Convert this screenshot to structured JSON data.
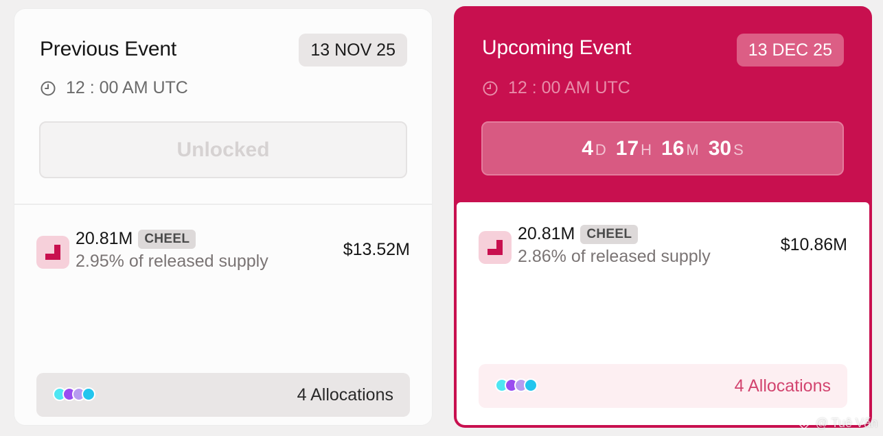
{
  "previous_event": {
    "title": "Previous Event",
    "date": "13 NOV 25",
    "time": "12 : 00 AM UTC",
    "status": "Unlocked",
    "token": {
      "amount": "20.81M",
      "ticker": "CHEEL",
      "supply": "2.95% of released supply",
      "value": "$13.52M"
    },
    "allocations_label": "4 Allocations"
  },
  "upcoming_event": {
    "title": "Upcoming Event",
    "date": "13 DEC 25",
    "time": "12 : 00 AM UTC",
    "countdown": {
      "days": "4",
      "days_unit": "D",
      "hours": "17",
      "hours_unit": "H",
      "minutes": "16",
      "minutes_unit": "M",
      "seconds": "30",
      "seconds_unit": "S"
    },
    "token": {
      "amount": "20.81M",
      "ticker": "CHEEL",
      "supply": "2.86% of released supply",
      "value": "$10.86M"
    },
    "allocations_label": "4 Allocations"
  },
  "allocation_dot_colors": [
    "#4ee6f2",
    "#9a4cf0",
    "#b79bf0",
    "#22c5ee"
  ],
  "colors": {
    "accent": "#c8104f",
    "accent_light": "#d85a82",
    "muted_badge": "#e9e6e6"
  },
  "icons": {
    "clock": "clock-icon",
    "token": "token-logo-icon",
    "watermark": "diamond-logo-icon"
  },
  "watermark": "@ Tuệ Vấn"
}
